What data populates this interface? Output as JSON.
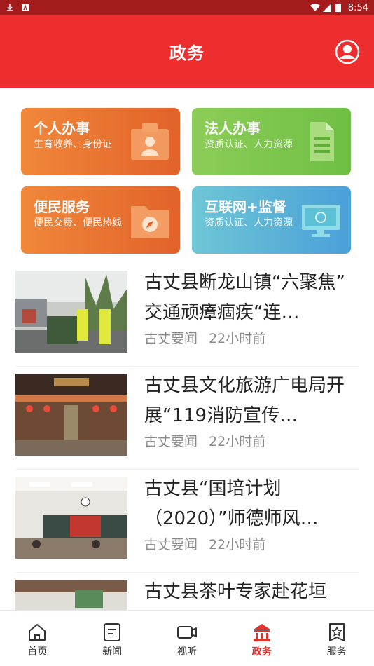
{
  "status_bar": {
    "time": "8:54"
  },
  "header": {
    "title": "政务",
    "profile_icon": "user-circle-icon"
  },
  "services": [
    {
      "title": "个人办事",
      "subtitle": "生育收养、身份证",
      "icon": "id-card-icon"
    },
    {
      "title": "法人办事",
      "subtitle": "资质认证、人力资源",
      "icon": "document-icon"
    },
    {
      "title": "便民服务",
      "subtitle": "便民交费、便民热线",
      "icon": "folder-compass-icon"
    },
    {
      "title": "互联网+监督",
      "subtitle": "资质认证、人力资源",
      "icon": "monitor-icon"
    }
  ],
  "news": [
    {
      "title": "古丈县断龙山镇“六聚焦” 交通顽瘴痼疾“连…",
      "source": "古丈要闻",
      "time": "22小时前"
    },
    {
      "title": "古丈县文化旅游广电局开展“119消防宣传…",
      "source": "古丈要闻",
      "time": "22小时前"
    },
    {
      "title": "古丈县“国培计划（2020）”师德师风…",
      "source": "古丈要闻",
      "time": "22小时前"
    },
    {
      "title": "古丈县茶叶专家赴花垣",
      "source": "",
      "time": ""
    }
  ],
  "bottom_nav": [
    {
      "label": "首页",
      "icon": "home-icon",
      "active": false
    },
    {
      "label": "新闻",
      "icon": "news-icon",
      "active": false
    },
    {
      "label": "视听",
      "icon": "video-icon",
      "active": false
    },
    {
      "label": "政务",
      "icon": "government-icon",
      "active": true
    },
    {
      "label": "服务",
      "icon": "service-icon",
      "active": false
    }
  ],
  "colors": {
    "header": "#ee2e2e",
    "status_bar": "#a51c1c",
    "active_tab": "#e2322d"
  }
}
